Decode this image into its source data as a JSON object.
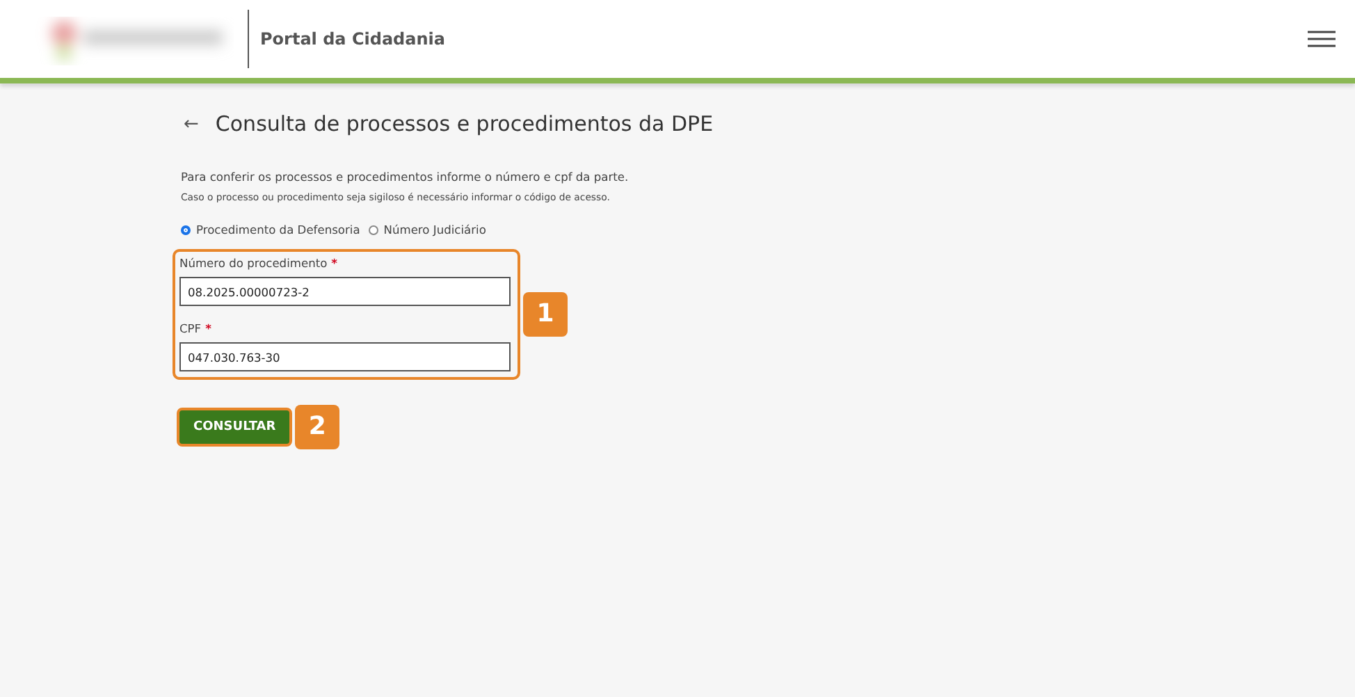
{
  "header": {
    "title": "Portal da Cidadania"
  },
  "page": {
    "back": "←",
    "title": "Consulta de processos e procedimentos da DPE",
    "intro": "Para conferir os processos e procedimentos informe o número e cpf da parte.",
    "note": "Caso o processo ou procedimento seja sigiloso é necessário informar o código de acesso."
  },
  "search_type": [
    {
      "label": "Procedimento da Defensoria",
      "selected": true
    },
    {
      "label": "Número Judiciário",
      "selected": false
    }
  ],
  "fields": [
    {
      "label": "Número do procedimento",
      "required": "*",
      "value": "08.2025.00000723-2"
    },
    {
      "label": "CPF",
      "required": "*",
      "value": "047.030.763-30"
    }
  ],
  "callouts": [
    "1",
    "2"
  ],
  "submit": "CONSULTAR"
}
